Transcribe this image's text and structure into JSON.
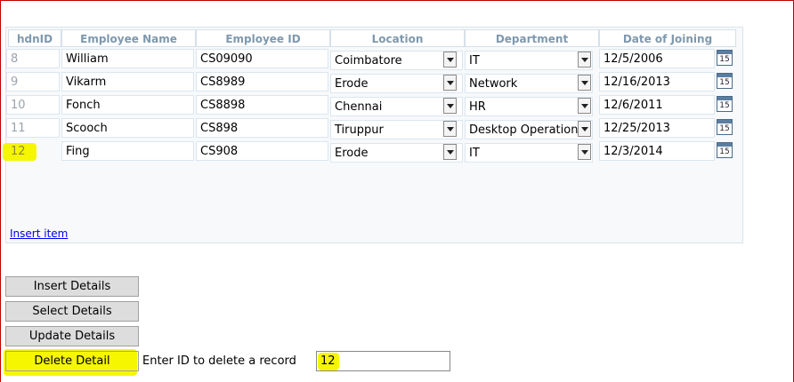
{
  "grid": {
    "headers": [
      "hdnID",
      "Employee Name",
      "Employee ID",
      "Location",
      "Department",
      "Date of Joining"
    ],
    "rows": [
      {
        "id": "8",
        "name": "William",
        "emp_id": "CS09090",
        "location": "Coimbatore",
        "department": "IT",
        "date": "12/5/2006"
      },
      {
        "id": "9",
        "name": "Vikarm",
        "emp_id": "CS8989",
        "location": "Erode",
        "department": "Network",
        "date": "12/16/2013"
      },
      {
        "id": "10",
        "name": "Fonch",
        "emp_id": "CS8898",
        "location": "Chennai",
        "department": "HR",
        "date": "12/6/2011"
      },
      {
        "id": "11",
        "name": "Scooch",
        "emp_id": "CS898",
        "location": "Tiruppur",
        "department": "Desktop Operation",
        "date": "12/25/2013"
      },
      {
        "id": "12",
        "name": "Fing",
        "emp_id": "CS908",
        "location": "Erode",
        "department": "IT",
        "date": "12/3/2014"
      }
    ],
    "calendar_day": "15",
    "insert_link": "Insert item"
  },
  "buttons": {
    "insert": "Insert Details",
    "select": "Select Details",
    "update": "Update Details",
    "delete": "Delete Detail"
  },
  "delete_form": {
    "label": "Enter ID to delete a record",
    "value": "12"
  },
  "colors": {
    "highlight": "#f6f600",
    "frame": "#c00000",
    "header_text": "#7f98ad"
  }
}
